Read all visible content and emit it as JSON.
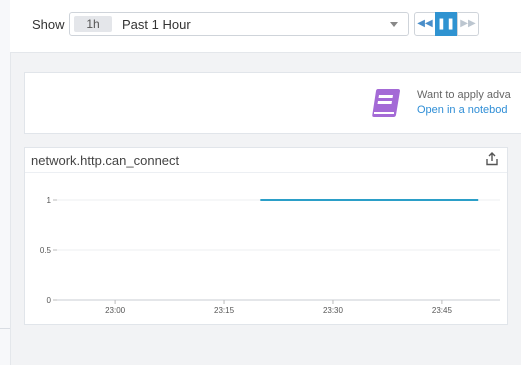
{
  "toolbar": {
    "show_label": "Show",
    "time_short": "1h",
    "time_label": "Past 1 Hour",
    "icons": [
      "chevron-down-icon",
      "rewind-icon",
      "pause-icon",
      "fast-forward-icon"
    ],
    "accent": "#2f93d1"
  },
  "promo": {
    "line1": "Want to apply adva",
    "line2": "Open in a notebod",
    "icon": "notebook-icon",
    "icon_color": "#a46ad6"
  },
  "widget": {
    "title": "network.http.can_connect",
    "icon": "share-export-icon"
  },
  "chart_data": {
    "type": "line",
    "title": "network.http.can_connect",
    "x_ticks": [
      "23:00",
      "23:15",
      "23:30",
      "23:45"
    ],
    "y_ticks": [
      "0",
      "0.5",
      "1"
    ],
    "ylim": [
      0,
      1.2
    ],
    "xlim": [
      "22:52",
      "23:53"
    ],
    "series": [
      {
        "color": "#2b9fc8",
        "points": [
          {
            "x": "23:20",
            "y": 1
          },
          {
            "x": "23:50",
            "y": 1
          }
        ]
      }
    ],
    "grid": true
  }
}
